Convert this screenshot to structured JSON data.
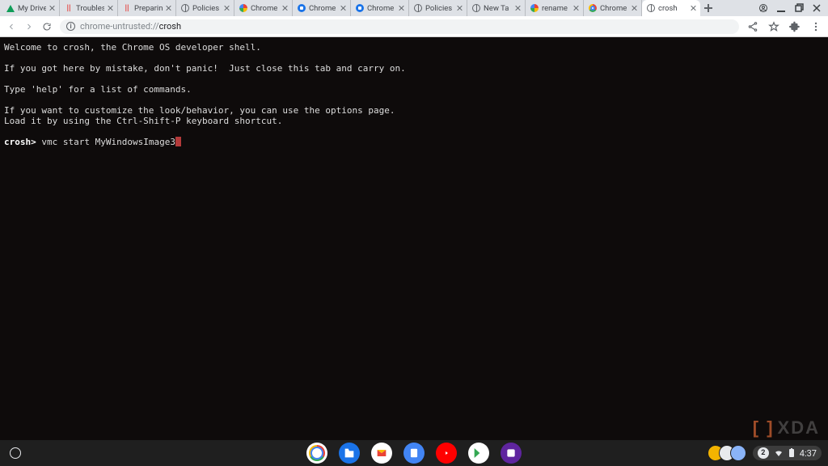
{
  "tabs": [
    {
      "favicon": "drive",
      "title": "My Drive"
    },
    {
      "favicon": "red",
      "title": "Troubles"
    },
    {
      "favicon": "red",
      "title": "Preparin"
    },
    {
      "favicon": "globe",
      "title": "Policies"
    },
    {
      "favicon": "google",
      "title": "Chrome"
    },
    {
      "favicon": "bluecir",
      "title": "Chrome"
    },
    {
      "favicon": "bluecir",
      "title": "Chrome"
    },
    {
      "favicon": "globe",
      "title": "Policies"
    },
    {
      "favicon": "globe",
      "title": "New Ta"
    },
    {
      "favicon": "google",
      "title": "rename"
    },
    {
      "favicon": "chrome",
      "title": "Chrome"
    },
    {
      "favicon": "globe",
      "title": "crosh",
      "active": true
    }
  ],
  "toolbar": {
    "url_prefix": "chrome-untrusted://",
    "url_path": "crosh"
  },
  "terminal": {
    "lines": [
      "Welcome to crosh, the Chrome OS developer shell.",
      "",
      "If you got here by mistake, don't panic!  Just close this tab and carry on.",
      "",
      "Type 'help' for a list of commands.",
      "",
      "If you want to customize the look/behavior, you can use the options page.",
      "Load it by using the Ctrl-Shift-P keyboard shortcut.",
      ""
    ],
    "prompt": "crosh>",
    "command": "vmc start MyWindowsImage3"
  },
  "shelf": {
    "apps": [
      {
        "name": "chrome",
        "bg": "#fff"
      },
      {
        "name": "files",
        "bg": "#1a73e8"
      },
      {
        "name": "gmail",
        "bg": "#fff"
      },
      {
        "name": "docs",
        "bg": "#4285f4"
      },
      {
        "name": "youtube",
        "bg": "#ff0000"
      },
      {
        "name": "play",
        "bg": "#fff"
      },
      {
        "name": "app-alt",
        "bg": "#5f259f"
      }
    ],
    "status": {
      "notif": "2",
      "time": "4:37"
    }
  },
  "watermark": "XDA"
}
